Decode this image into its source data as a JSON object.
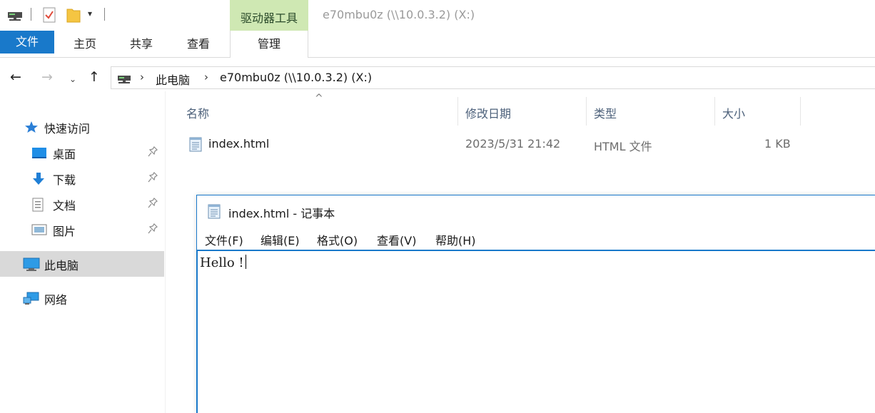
{
  "window": {
    "title": "e70mbu0z (\\\\10.0.3.2) (X:)",
    "context_tab_header": "驱动器工具"
  },
  "quick_access": {
    "icons": [
      "drive-icon",
      "properties-icon",
      "new-folder-icon",
      "customize-dropdown-icon"
    ]
  },
  "ribbon": {
    "tabs": [
      "文件",
      "主页",
      "共享",
      "查看",
      "管理"
    ],
    "active_tab": "文件",
    "accent": "#1979ca",
    "context_color": "#cfe8b3"
  },
  "address": {
    "crumbs": [
      "此电脑",
      "e70mbu0z (\\\\10.0.3.2) (X:)"
    ],
    "sort_indicator": "^"
  },
  "nav_pane": {
    "quick_access_label": "快速访问",
    "items": [
      {
        "label": "桌面",
        "icon": "desktop-icon",
        "pinned": true
      },
      {
        "label": "下载",
        "icon": "download-icon",
        "pinned": true
      },
      {
        "label": "文档",
        "icon": "document-icon",
        "pinned": true
      },
      {
        "label": "图片",
        "icon": "pictures-icon",
        "pinned": true
      }
    ],
    "this_pc": "此电脑",
    "network": "网络"
  },
  "file_list": {
    "columns": [
      "名称",
      "修改日期",
      "类型",
      "大小"
    ],
    "rows": [
      {
        "name": "index.html",
        "modified": "2023/5/31 21:42",
        "type": "HTML 文件",
        "size": "1 KB",
        "icon": "notepad-file-icon"
      }
    ]
  },
  "notepad": {
    "title": "index.html - 记事本",
    "menu": [
      "文件(F)",
      "编辑(E)",
      "格式(O)",
      "查看(V)",
      "帮助(H)"
    ],
    "content": "Hello !"
  }
}
